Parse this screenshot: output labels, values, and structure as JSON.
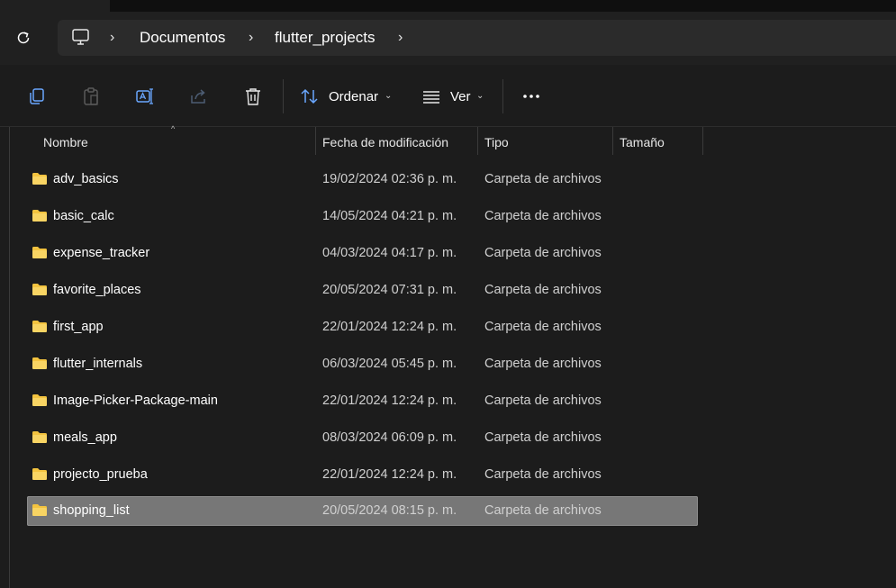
{
  "address_bar": {
    "breadcrumbs": [
      "Documentos",
      "flutter_projects"
    ]
  },
  "toolbar": {
    "sort_label": "Ordenar",
    "view_label": "Ver",
    "more_label": "..."
  },
  "columns": {
    "name": "Nombre",
    "modified": "Fecha de modificación",
    "type": "Tipo",
    "size": "Tamaño"
  },
  "files": [
    {
      "name": "adv_basics",
      "modified": "19/02/2024 02:36 p. m.",
      "type": "Carpeta de archivos"
    },
    {
      "name": "basic_calc",
      "modified": "14/05/2024 04:21 p. m.",
      "type": "Carpeta de archivos"
    },
    {
      "name": "expense_tracker",
      "modified": "04/03/2024 04:17 p. m.",
      "type": "Carpeta de archivos"
    },
    {
      "name": "favorite_places",
      "modified": "20/05/2024 07:31 p. m.",
      "type": "Carpeta de archivos"
    },
    {
      "name": "first_app",
      "modified": "22/01/2024 12:24 p. m.",
      "type": "Carpeta de archivos"
    },
    {
      "name": "flutter_internals",
      "modified": "06/03/2024 05:45 p. m.",
      "type": "Carpeta de archivos"
    },
    {
      "name": "Image-Picker-Package-main",
      "modified": "22/01/2024 12:24 p. m.",
      "type": "Carpeta de archivos"
    },
    {
      "name": "meals_app",
      "modified": "08/03/2024 06:09 p. m.",
      "type": "Carpeta de archivos"
    },
    {
      "name": "projecto_prueba",
      "modified": "22/01/2024 12:24 p. m.",
      "type": "Carpeta de archivos"
    },
    {
      "name": "shopping_list",
      "modified": "20/05/2024 08:15 p. m.",
      "type": "Carpeta de archivos"
    }
  ],
  "selected_file": "shopping_list",
  "colors": {
    "background": "#1c1c1c",
    "folder": "#f3c33f",
    "selection": "#777777",
    "accent_icon": "#6aa7ff"
  }
}
